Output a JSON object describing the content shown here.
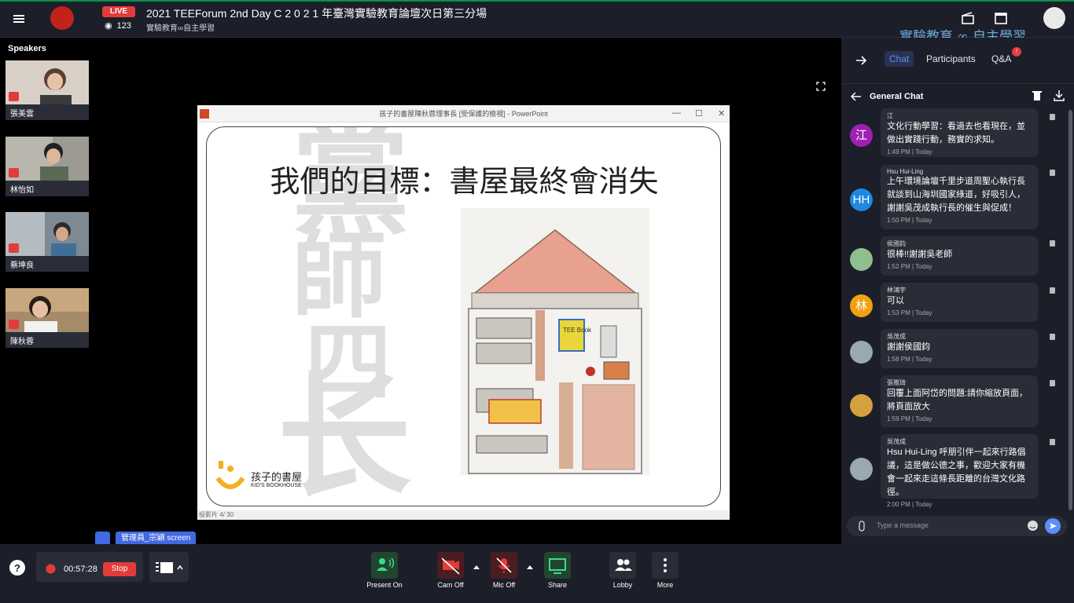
{
  "header": {
    "live_badge": "LIVE",
    "viewers": "123",
    "title": "2021 TEEForum 2nd Day C 2 0 2 1 年臺灣實驗教育論壇次日第三分場",
    "subtitle": "實驗教育∞自主學習",
    "brand_text": "實驗教育 ∞ 自主學習"
  },
  "speakers": {
    "label": "Speakers",
    "items": [
      {
        "name": "張美雲"
      },
      {
        "name": "林怡如"
      },
      {
        "name": "蔡坤良"
      },
      {
        "name": "陳秋蓉"
      }
    ]
  },
  "presentation": {
    "window_title": "孩子的書屋陳秋蓉理事長 [受保護的檢視] - PowerPoint",
    "slide_heading": "我們的目標：書屋最終會消失",
    "calligraphy": [
      "黨",
      "師",
      "四",
      "长"
    ],
    "logo_name": "孩子的書屋",
    "logo_en": "KID'S BOOKHOUSE",
    "drawing_sign": "TEE Book",
    "status": "投影片 4/ 30"
  },
  "screen_share": {
    "label": "管理員_宗穎 screen"
  },
  "chat": {
    "tabs": [
      "Chat",
      "Participants",
      "Q&A"
    ],
    "qa_badge": "!",
    "general_chat": "General Chat",
    "input_placeholder": "Type a message",
    "messages": [
      {
        "initial": "江",
        "author": "江",
        "text": "文化行動學習：看過去也看現在，並做出實踐行動，務實的求知。",
        "time": "1:49 PM | Today",
        "color": "#a020b4"
      },
      {
        "initial": "HH",
        "author": "Hsu Hui-Ling",
        "text": "上午環境論壇千里步道周聖心執行長就談到山海圳國家綠道，好吸引人，謝謝吳茂成執行長的催生與促成！",
        "time": "1:50 PM | Today",
        "color": "#1e88e5"
      },
      {
        "initial": "",
        "author": "侯國鈞",
        "text": "很棒!!謝謝吳老師",
        "time": "1:52 PM | Today",
        "color": "#8fbf8f"
      },
      {
        "initial": "林",
        "author": "林鴻宇",
        "text": "可以",
        "time": "1:53 PM | Today",
        "color": "#f0a010"
      },
      {
        "initial": "",
        "author": "吳茂成",
        "text": "謝謝侯國鈞",
        "time": "1:58 PM | Today",
        "color": "#9aa8b0"
      },
      {
        "initial": "",
        "author": "張雅琦",
        "text": "回覆上面阿岱的問題:請你縮放頁面，將頁面放大",
        "time": "1:59 PM | Today",
        "color": "#d4a040"
      },
      {
        "initial": "",
        "author": "吳茂成",
        "text": "Hsu Hui-Ling 呼朋引伴一起來行路倡議，這是做公德之事，歡迎大家有機會一起來走這條長距離的台灣文化路徑。",
        "time": "2:00 PM | Today",
        "color": "#9aa8b0"
      }
    ]
  },
  "controls": {
    "timer": "00:57:28",
    "stop": "Stop",
    "present_on": "Present On",
    "cam_off": "Cam Off",
    "mic_off": "Mic Off",
    "share": "Share",
    "lobby": "Lobby",
    "more": "More"
  }
}
